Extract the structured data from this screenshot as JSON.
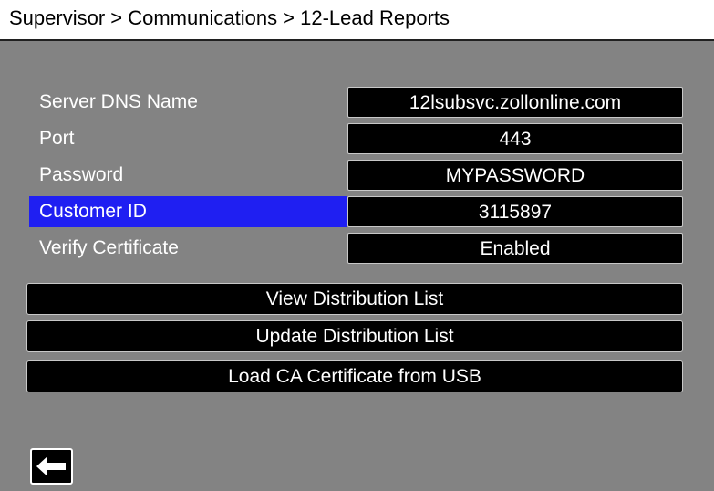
{
  "header": {
    "title": "Supervisor > Communications > 12-Lead Reports"
  },
  "fields": [
    {
      "label": "Server DNS Name",
      "value": "12lsubsvc.zollonline.com"
    },
    {
      "label": "Port",
      "value": "443"
    },
    {
      "label": "Password",
      "value": "MYPASSWORD"
    },
    {
      "label": "Customer ID",
      "value": "3115897"
    },
    {
      "label": "Verify Certificate",
      "value": "Enabled"
    }
  ],
  "buttons": {
    "view_distribution_list": "View Distribution List",
    "update_distribution_list": "Update Distribution List",
    "load_ca_certificate": "Load CA Certificate from USB"
  },
  "back_button": {
    "icon": "arrow-left-icon"
  },
  "colors": {
    "background": "#838383",
    "selected": "#1f1ff2",
    "field": "#000000",
    "header": "#ffffff"
  }
}
